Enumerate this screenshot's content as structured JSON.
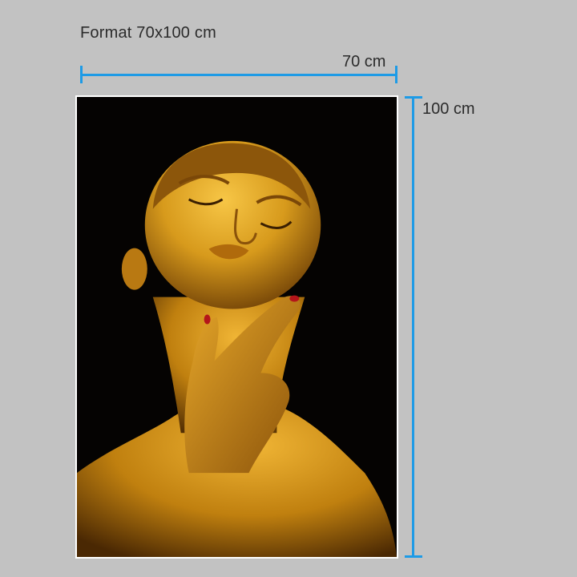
{
  "format_label": "Format 70x100 cm",
  "width_label": "70 cm",
  "height_label": "100 cm",
  "colors": {
    "background": "#c2c2c2",
    "dimension_line": "#1e9be6",
    "text": "#2b2b2b",
    "poster_frame": "#ffffff",
    "poster_background": "#050302",
    "gold_skin": "#d79a1c"
  }
}
